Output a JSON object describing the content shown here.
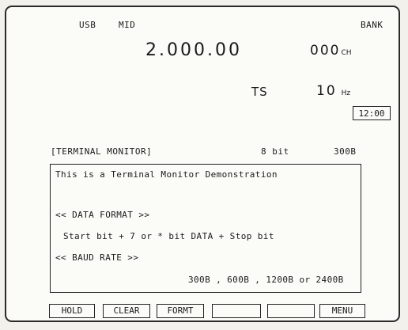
{
  "status": {
    "mode": "USB",
    "vfo": "MID",
    "bank": "BANK"
  },
  "frequency": "2.000.00",
  "channel": {
    "value": "000",
    "unit": "CH"
  },
  "tuning_step": {
    "label": "TS",
    "value": "10",
    "unit": "Hz"
  },
  "clock": "12:00",
  "terminal": {
    "title": "[TERMINAL MONITOR]",
    "data_bits": "8 bit",
    "baud": "300B",
    "lines": [
      "This is a Terminal Monitor Demonstration",
      "<< DATA FORMAT >>",
      "Start bit + 7 or * bit DATA + Stop bit",
      "<< BAUD RATE >>",
      "300B , 600B , 1200B or 2400B"
    ]
  },
  "softkeys": [
    "HOLD",
    "CLEAR",
    "FORMT",
    "",
    "",
    "MENU"
  ]
}
